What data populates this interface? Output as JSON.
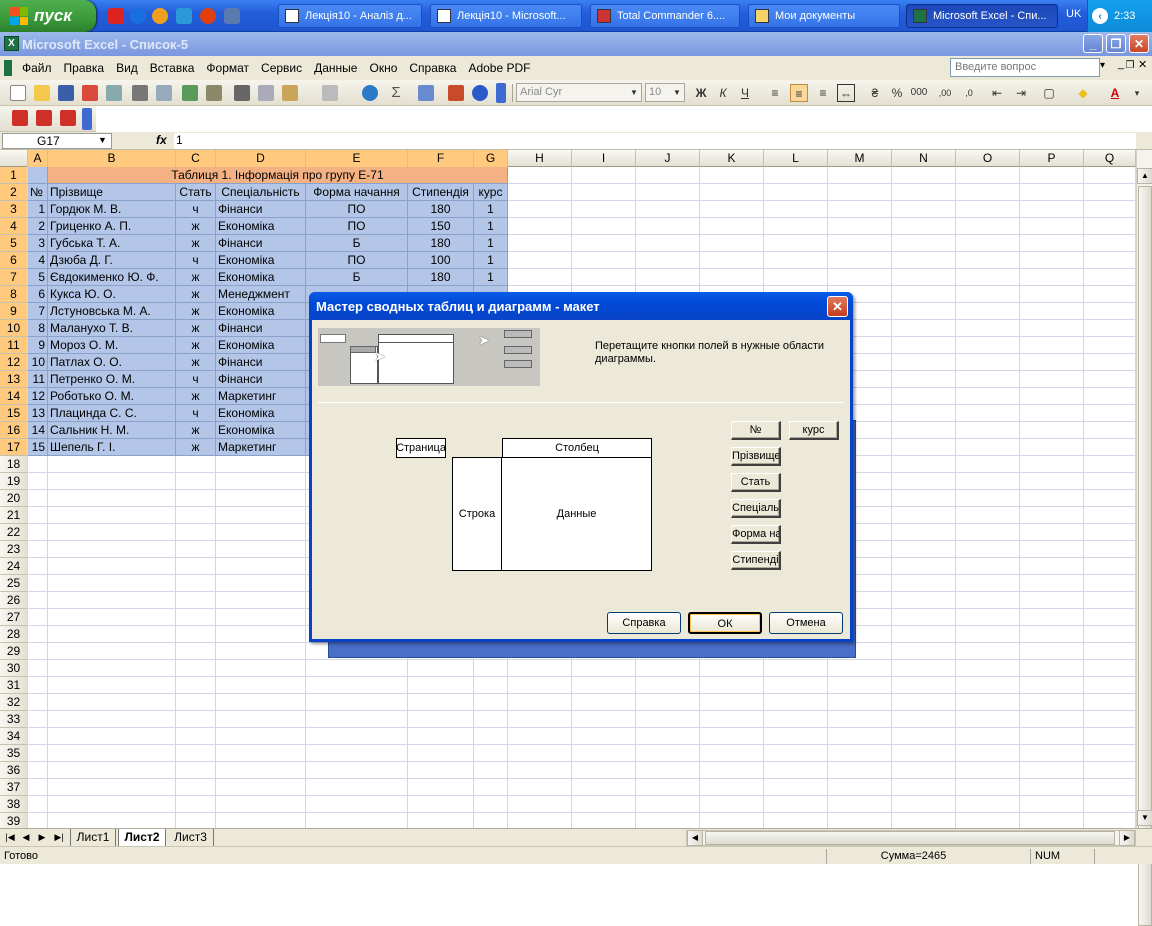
{
  "taskbar": {
    "start_label": "пуск",
    "tasks": [
      {
        "label": "Лекція10 - Аналіз д..."
      },
      {
        "label": "Лекція10 - Microsoft..."
      },
      {
        "label": "Total Commander 6...."
      },
      {
        "label": "Мои документы"
      },
      {
        "label": "Microsoft Excel - Спи..."
      }
    ],
    "language": "UK",
    "clock": "2:33"
  },
  "window": {
    "title": "Microsoft Excel - Список-5"
  },
  "menu": {
    "items": [
      "Файл",
      "Правка",
      "Вид",
      "Вставка",
      "Формат",
      "Сервис",
      "Данные",
      "Окно",
      "Справка",
      "Adobe PDF"
    ],
    "ask_placeholder": "Введите вопрос"
  },
  "toolbar": {
    "font_name": "Arial Cyr",
    "font_size": "10"
  },
  "formula_bar": {
    "cell_ref": "G17",
    "fx": "fx",
    "value": "1"
  },
  "sheet": {
    "columns": [
      "A",
      "B",
      "C",
      "D",
      "E",
      "F",
      "G",
      "H",
      "I",
      "J",
      "K",
      "L",
      "M",
      "N",
      "O",
      "P",
      "Q"
    ],
    "rows": [
      "1",
      "2",
      "3",
      "4",
      "5",
      "6",
      "7",
      "8",
      "9",
      "10",
      "11",
      "12",
      "13",
      "14",
      "15",
      "16",
      "17",
      "18",
      "19",
      "20",
      "21",
      "22",
      "23",
      "24",
      "25",
      "26",
      "27",
      "28",
      "29",
      "30",
      "31",
      "32",
      "33",
      "34",
      "35",
      "36",
      "37",
      "38",
      "39"
    ],
    "table_title": "Таблиця 1. Інформація про групу Е-71",
    "headers": [
      "№",
      "Прізвище",
      "Стать",
      "Спеціальність",
      "Форма начання",
      "Стипендія",
      "курс"
    ],
    "records": [
      [
        "1",
        "Гордюк М. В.",
        "ч",
        "Фінанси",
        "ПО",
        "180",
        "1"
      ],
      [
        "2",
        "Гриценко А. П.",
        "ж",
        "Економіка",
        "ПО",
        "150",
        "1"
      ],
      [
        "3",
        "Губська Т. А.",
        "ж",
        "Фінанси",
        "Б",
        "180",
        "1"
      ],
      [
        "4",
        "Дзюба Д. Г.",
        "ч",
        "Економіка",
        "ПО",
        "100",
        "1"
      ],
      [
        "5",
        "Євдокименко Ю. Ф.",
        "ж",
        "Економіка",
        "Б",
        "180",
        "1"
      ],
      [
        "6",
        "Кукса Ю. О.",
        "ж",
        "Менеджмент",
        "",
        "",
        ""
      ],
      [
        "7",
        "Лстуновська М. А.",
        "ж",
        "Економіка",
        "",
        "",
        ""
      ],
      [
        "8",
        "Маланухо Т. В.",
        "ж",
        "Фінанси",
        "",
        "",
        ""
      ],
      [
        "9",
        "Мороз О. М.",
        "ж",
        "Економіка",
        "",
        "",
        ""
      ],
      [
        "10",
        "Патлах О. О.",
        "ж",
        "Фінанси",
        "",
        "",
        ""
      ],
      [
        "11",
        "Петренко О. М.",
        "ч",
        "Фінанси",
        "",
        "",
        ""
      ],
      [
        "12",
        "Роботько О. М.",
        "ж",
        "Маркетинг",
        "",
        "",
        ""
      ],
      [
        "13",
        "Плацинда С. С.",
        "ч",
        "Економіка",
        "",
        "",
        ""
      ],
      [
        "14",
        "Сальник Н. М.",
        "ж",
        "Економіка",
        "",
        "",
        ""
      ],
      [
        "15",
        "Шепель Г. І.",
        "ж",
        "Маркетинг",
        "",
        "",
        ""
      ]
    ],
    "tabs": [
      "Лист1",
      "Лист2",
      "Лист3"
    ],
    "active_tab": "Лист2"
  },
  "status": {
    "ready": "Готово",
    "sum": "Сумма=2465",
    "num": "NUM"
  },
  "dialog": {
    "title": "Мастер сводных таблиц и диаграмм - макет",
    "instruction": "Перетащите кнопки полей в нужные области диаграммы.",
    "page_zone": "Страница",
    "column_zone": "Столбец",
    "row_zone": "Строка",
    "data_zone": "Данные",
    "fields": [
      "№",
      "курс",
      "Прізвище",
      "Стать",
      "Спеціальн",
      "Форма на",
      "Стипенді"
    ],
    "help_button": "Справка",
    "ok_button": "ОК",
    "cancel_button": "Отмена"
  },
  "colors": {
    "header_fill": "#f4b183",
    "selection_fill": "#b3c6e7",
    "dialog_title": "#0a5ce8"
  }
}
